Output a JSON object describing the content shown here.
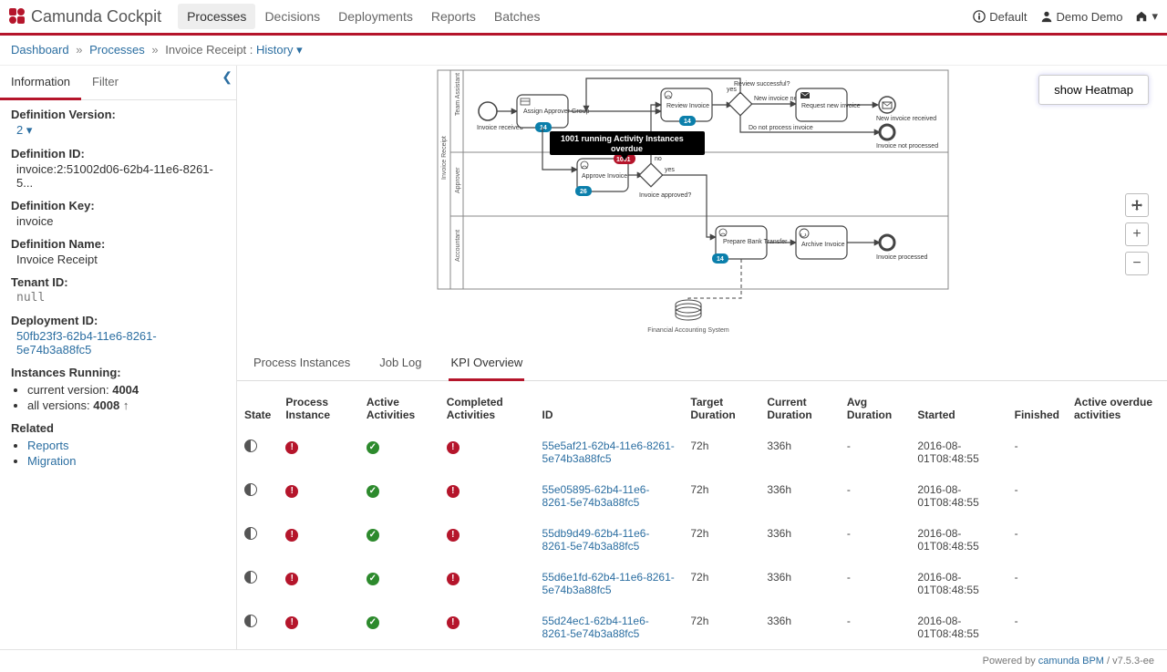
{
  "brand": "Camunda Cockpit",
  "nav": {
    "items": [
      "Processes",
      "Decisions",
      "Deployments",
      "Reports",
      "Batches"
    ],
    "active": 0
  },
  "userbar": {
    "org": "Default",
    "user": "Demo Demo"
  },
  "breadcrumb": {
    "dashboard": "Dashboard",
    "processes": "Processes",
    "process_name": "Invoice Receipt",
    "view": "History"
  },
  "sidebar": {
    "tabs": {
      "info": "Information",
      "filter": "Filter",
      "active": "info"
    },
    "definition_version_label": "Definition Version:",
    "definition_version_value": "2",
    "definition_id_label": "Definition ID:",
    "definition_id_value": "invoice:2:51002d06-62b4-11e6-8261-5...",
    "definition_key_label": "Definition Key:",
    "definition_key_value": "invoice",
    "definition_name_label": "Definition Name:",
    "definition_name_value": "Invoice Receipt",
    "tenant_id_label": "Tenant ID:",
    "tenant_id_value": "null",
    "deployment_id_label": "Deployment ID:",
    "deployment_id_value": "50fb23f3-62b4-11e6-8261-5e74b3a88fc5",
    "instances_running_label": "Instances Running:",
    "instances_current_label": "current version:",
    "instances_current_value": "4004",
    "instances_all_label": "all versions:",
    "instances_all_value": "4008",
    "related_label": "Related",
    "related_links": [
      "Reports",
      "Migration"
    ]
  },
  "diagram": {
    "heatmap_btn": "show Heatmap",
    "tooltip": "1001 running Activity Instances overdue",
    "lanes": [
      "Team Assistant",
      "Approver",
      "Accountant"
    ],
    "pool_title": "Invoice Receipt",
    "tasks": {
      "assign": "Assign Approver Group",
      "review": "Review Invoice",
      "request": "Request new invoice",
      "approve": "Approve Invoice",
      "prepare": "Prepare Bank Transfer",
      "archive": "Archive Invoice"
    },
    "gw_labels": {
      "review_q": "Review successful?",
      "approved_q": "Invoice approved?"
    },
    "edge_labels": {
      "yes": "yes",
      "no": "no",
      "new_inv": "New invoice necessary",
      "dont": "Do not process invoice"
    },
    "end_labels": {
      "received": "Invoice received",
      "new": "New invoice received",
      "not": "Invoice not processed",
      "processed": "Invoice processed"
    },
    "badges": {
      "assign": "14",
      "review": "14",
      "approve": "26",
      "prepare": "14",
      "overdue": "1001"
    },
    "datastore": "Financial Accounting System"
  },
  "detail_tabs": {
    "pi": "Process Instances",
    "job": "Job Log",
    "kpi": "KPI Overview",
    "active": "kpi"
  },
  "kpi": {
    "headers": {
      "state": "State",
      "pi": "Process Instance",
      "active": "Active Activities",
      "completed": "Completed Activities",
      "id": "ID",
      "target": "Target Duration",
      "current": "Current Duration",
      "avg": "Avg Duration",
      "started": "Started",
      "finished": "Finished",
      "overdue": "Active overdue activities"
    },
    "rows": [
      {
        "id": "55e5af21-62b4-11e6-8261-5e74b3a88fc5",
        "target": "72h",
        "current": "336h",
        "avg": "-",
        "started": "2016-08-01T08:48:55",
        "finished": "-"
      },
      {
        "id": "55e05895-62b4-11e6-8261-5e74b3a88fc5",
        "target": "72h",
        "current": "336h",
        "avg": "-",
        "started": "2016-08-01T08:48:55",
        "finished": "-"
      },
      {
        "id": "55db9d49-62b4-11e6-8261-5e74b3a88fc5",
        "target": "72h",
        "current": "336h",
        "avg": "-",
        "started": "2016-08-01T08:48:55",
        "finished": "-"
      },
      {
        "id": "55d6e1fd-62b4-11e6-8261-5e74b3a88fc5",
        "target": "72h",
        "current": "336h",
        "avg": "-",
        "started": "2016-08-01T08:48:55",
        "finished": "-"
      },
      {
        "id": "55d24ec1-62b4-11e6-8261-5e74b3a88fc5",
        "target": "72h",
        "current": "336h",
        "avg": "-",
        "started": "2016-08-01T08:48:55",
        "finished": "-"
      }
    ]
  },
  "footer": {
    "powered": "Powered by",
    "product": "camunda BPM",
    "version": "/ v7.5.3-ee"
  }
}
